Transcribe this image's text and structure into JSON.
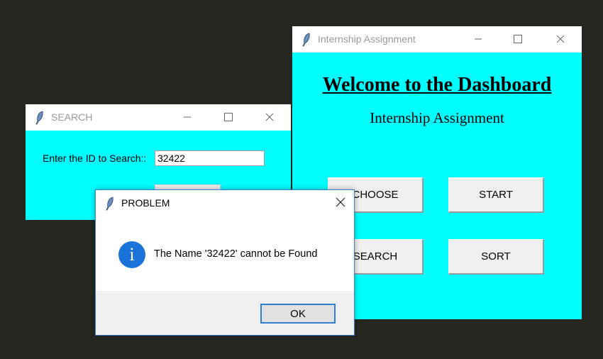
{
  "dashboard": {
    "window_title": "Internship Assignment",
    "heading": "Welcome to the Dashboard",
    "subheading": "Internship Assignment",
    "buttons": {
      "choose": "CHOOSE",
      "start": "START",
      "search": "SEARCH",
      "sort": "SORT"
    },
    "background": "#00ffff"
  },
  "search_window": {
    "window_title": "SEARCH",
    "label": "Enter the ID to Search::",
    "input_value": "32422"
  },
  "dialog": {
    "title": "PROBLEM",
    "message": "The Name '32422' cannot be Found",
    "ok_label": "OK",
    "icon": "info-icon",
    "icon_glyph": "i",
    "accent": "#1a73d9"
  }
}
